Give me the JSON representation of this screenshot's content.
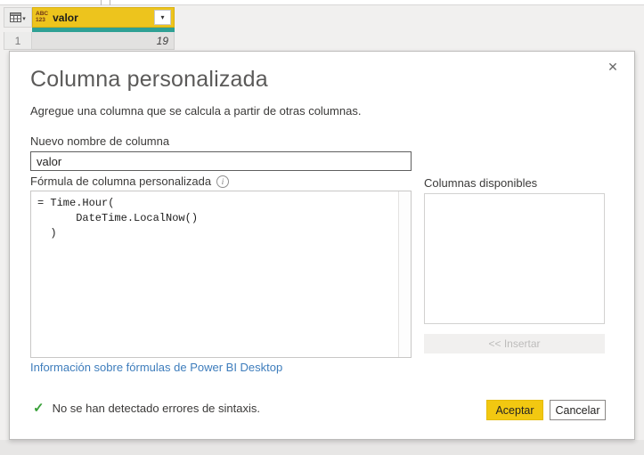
{
  "table": {
    "header": {
      "type_icon_line1": "ABC",
      "type_icon_line2": "123",
      "column_name": "valor"
    },
    "rows": [
      {
        "index": "1",
        "value": "19"
      }
    ]
  },
  "dialog": {
    "title": "Columna personalizada",
    "subtitle": "Agregue una columna que se calcula a partir de otras columnas.",
    "name_label": "Nuevo nombre de columna",
    "name_value": "valor",
    "formula_label": "Fórmula de columna personalizada",
    "formula_code": "= Time.Hour(\n      DateTime.LocalNow()\n  )",
    "available_columns_label": "Columnas disponibles",
    "insert_button_label": "<< Insertar",
    "help_link": "Información sobre fórmulas de Power BI Desktop",
    "status_message": "No se han detectado errores de sintaxis.",
    "accept_button_label": "Aceptar",
    "cancel_button_label": "Cancelar"
  },
  "icons": {
    "close": "✕",
    "check": "✓",
    "dropdown": "▾",
    "info": "i"
  },
  "colors": {
    "selected_column_header": "#edc41d",
    "teal_underline": "#2fa094",
    "accent_button": "#f2c811",
    "link_blue": "#3e7dbc",
    "success_green": "#38a038",
    "type_icon_maroon": "#6e3418"
  }
}
